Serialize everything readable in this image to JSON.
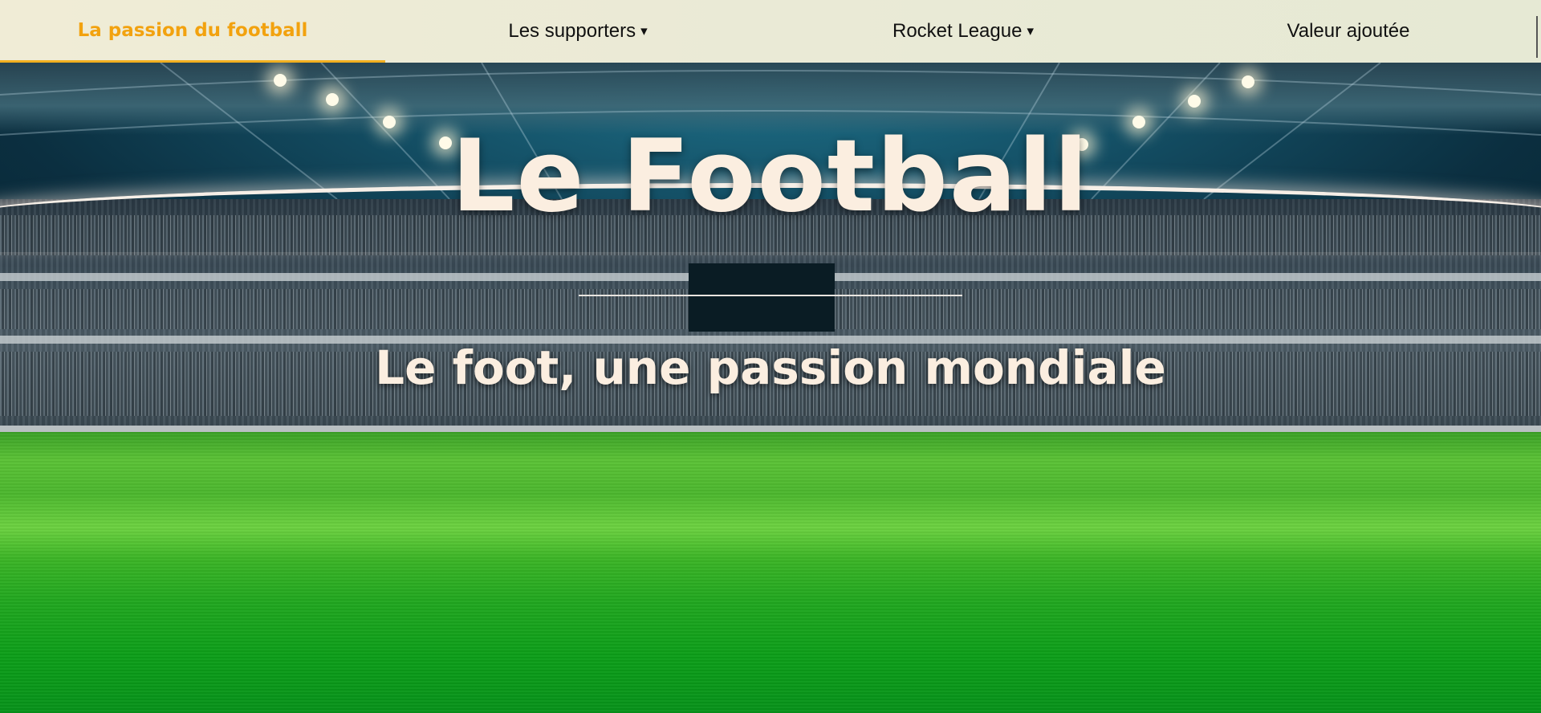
{
  "nav": {
    "items": [
      {
        "label": "La passion du football",
        "active": true,
        "has_caret": false
      },
      {
        "label": "Les supporters",
        "active": false,
        "has_caret": true
      },
      {
        "label": "Rocket League",
        "active": false,
        "has_caret": true
      },
      {
        "label": "Valeur ajoutée",
        "active": false,
        "has_caret": false
      }
    ],
    "caret": "▾"
  },
  "hero": {
    "title": "Le Football",
    "subtitle": "Le foot, une passion mondiale"
  },
  "colors": {
    "accent": "#f2a20f",
    "title_text": "#fbeee0",
    "nav_bg": "#eceadb",
    "pitch_green": "#1aa521"
  }
}
